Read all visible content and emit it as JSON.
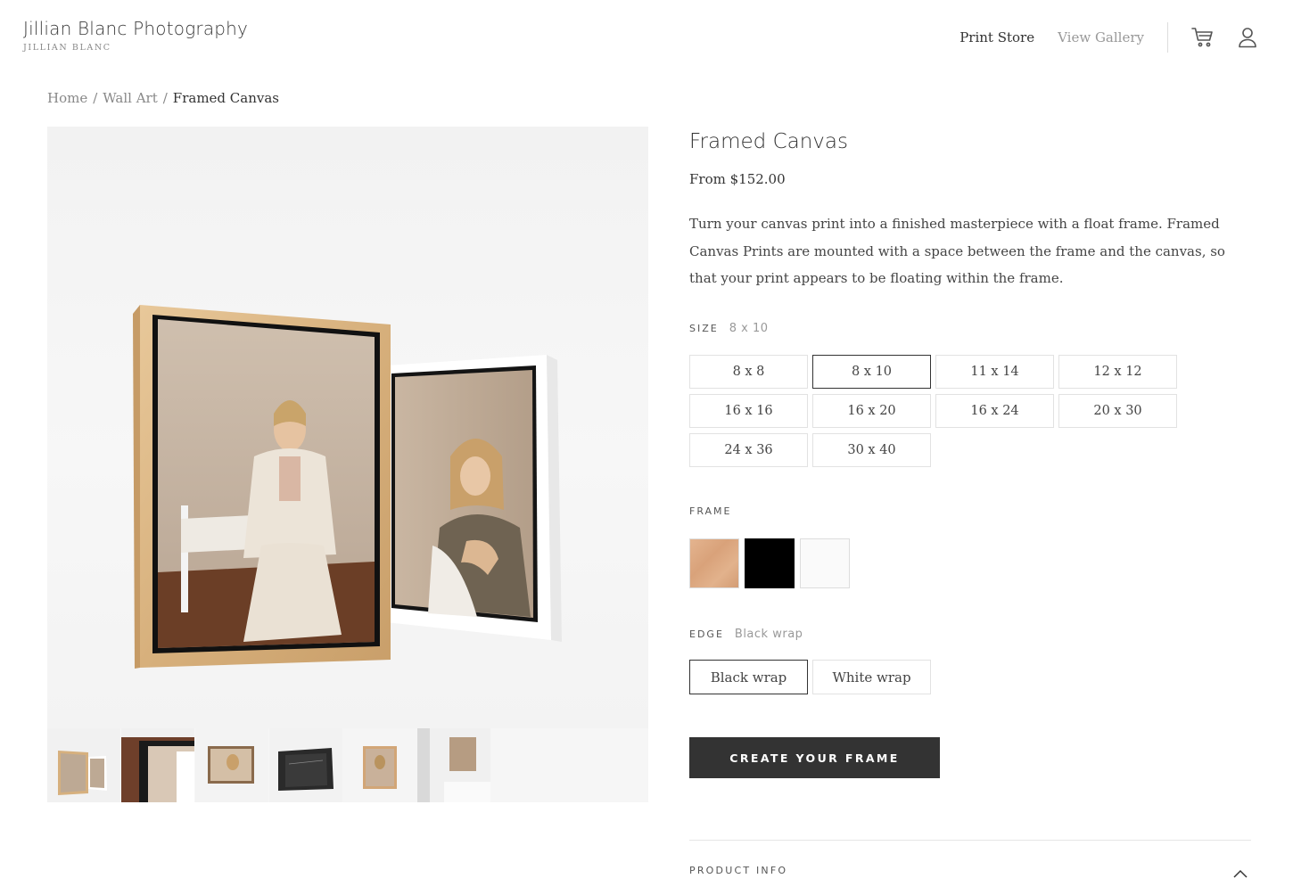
{
  "header": {
    "brand_title": "Jillian Blanc Photography",
    "brand_subtitle": "JILLIAN BLANC",
    "nav": [
      {
        "label": "Print Store"
      },
      {
        "label": "View Gallery"
      }
    ],
    "icons": [
      "cart-icon",
      "user-icon"
    ]
  },
  "breadcrumb": {
    "items": [
      "Home",
      "Wall Art",
      "Framed Canvas"
    ],
    "separator": "/"
  },
  "product": {
    "title": "Framed Canvas",
    "price": "From $152.00",
    "description": "Turn your canvas print into a finished masterpiece with a float frame. Framed Canvas Prints are mounted with a space between the frame and the canvas, so that your print appears to be floating within the frame."
  },
  "size": {
    "label": "SIZE",
    "selected": "8 x 10",
    "options": [
      "8 x 8",
      "8 x 10",
      "11 x 14",
      "12 x 12",
      "16 x 16",
      "16 x 20",
      "16 x 24",
      "20 x 30",
      "24 x 36",
      "30 x 40"
    ]
  },
  "frame": {
    "label": "FRAME",
    "options": [
      {
        "name": "wood",
        "color": "#dcaa82"
      },
      {
        "name": "black",
        "color": "#000000"
      },
      {
        "name": "white",
        "color": "#fafafa"
      }
    ]
  },
  "edge": {
    "label": "EDGE",
    "selected": "Black wrap",
    "options": [
      "Black wrap",
      "White wrap"
    ]
  },
  "cta": {
    "label": "CREATE YOUR FRAME"
  },
  "accordion": {
    "label": "PRODUCT INFO"
  },
  "colors": {
    "cta_bg": "#333333",
    "text": "#333333",
    "muted": "#999999",
    "border": "#e2e2e2"
  }
}
